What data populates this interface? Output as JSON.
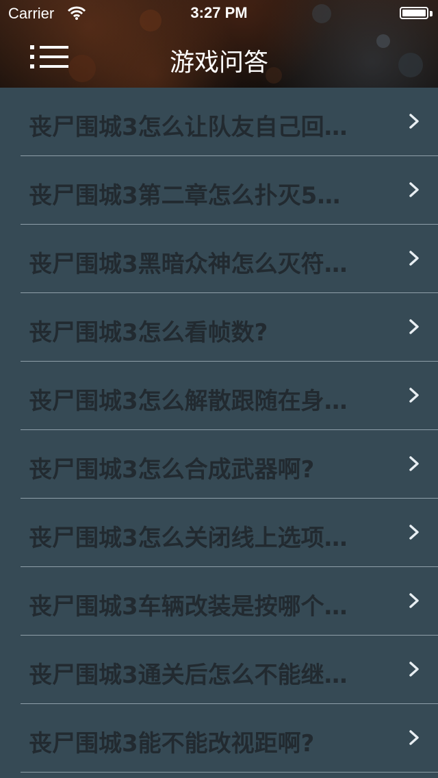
{
  "status_bar": {
    "carrier": "Carrier",
    "time": "3:27 PM",
    "battery_level": 1.0
  },
  "nav": {
    "title": "游戏问答",
    "menu_icon": "menu-list-icon"
  },
  "colors": {
    "list_background": "#364a55",
    "text": "#222a30",
    "separator": "#8fa0aa",
    "chevron": "#e8eef2"
  },
  "items": [
    {
      "label": "丧尸围城3怎么让队友自己回…"
    },
    {
      "label": "丧尸围城3第二章怎么扑灭5…"
    },
    {
      "label": "丧尸围城3黑暗众神怎么灭符…"
    },
    {
      "label": "丧尸围城3怎么看帧数?"
    },
    {
      "label": "丧尸围城3怎么解散跟随在身…"
    },
    {
      "label": "丧尸围城3怎么合成武器啊?"
    },
    {
      "label": "丧尸围城3怎么关闭线上选项…"
    },
    {
      "label": "丧尸围城3车辆改装是按哪个…"
    },
    {
      "label": "丧尸围城3通关后怎么不能继…"
    },
    {
      "label": "丧尸围城3能不能改视距啊?"
    }
  ]
}
